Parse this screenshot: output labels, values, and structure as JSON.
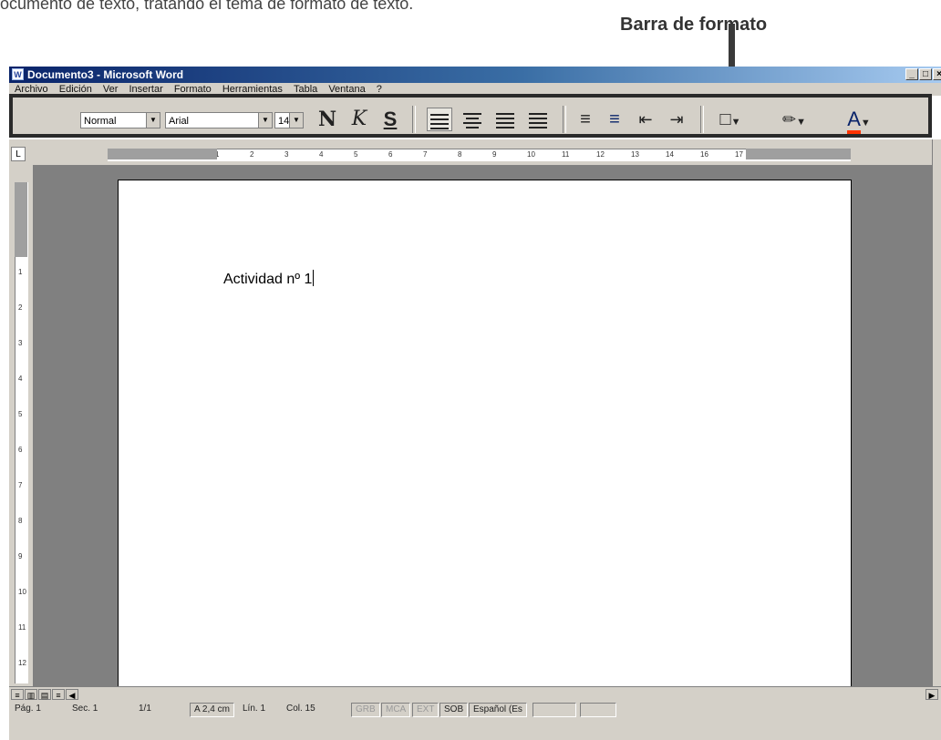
{
  "intro_text": "ocumento de texto, tratando el tema de formato de texto.",
  "annotation_label": "Barra de formato",
  "window": {
    "title": "Documento3 - Microsoft Word",
    "app_icon": "W",
    "buttons": [
      "_",
      "□",
      "×"
    ]
  },
  "menu": [
    "Archivo",
    "Edición",
    "Ver",
    "Insertar",
    "Formato",
    "Herramientas",
    "Tabla",
    "Ventana",
    "?"
  ],
  "toolbar": {
    "style": "Normal",
    "font": "Arial",
    "size": "14",
    "bold": "N",
    "italic": "K",
    "underline": "S",
    "icons": [
      "align-left-icon",
      "align-center-icon",
      "align-right-icon",
      "justify-icon",
      "numbered-list-icon",
      "bulleted-list-icon",
      "decrease-indent-icon",
      "increase-indent-icon",
      "borders-icon",
      "highlight-icon",
      "font-color-icon"
    ]
  },
  "ruler": {
    "corner": "L",
    "h_ticks": [
      "3",
      "2",
      "1",
      "1",
      "2",
      "3",
      "4",
      "5",
      "6",
      "7",
      "8",
      "9",
      "10",
      "11",
      "12",
      "13",
      "14",
      "16",
      "17"
    ],
    "v_ticks": [
      "2",
      "1",
      "1",
      "2",
      "3",
      "4",
      "5",
      "6",
      "7",
      "8",
      "9",
      "10",
      "11",
      "12"
    ]
  },
  "document": {
    "text": "Actividad nº 1"
  },
  "status": {
    "page": "Pág. 1",
    "section": "Sec. 1",
    "pages": "1/1",
    "at": "A 2,4 cm",
    "line": "Lín. 1",
    "col": "Col. 15",
    "grb": "GRB",
    "mca": "MCA",
    "ext": "EXT",
    "sob": "SOB",
    "lang": "Español (Es"
  }
}
